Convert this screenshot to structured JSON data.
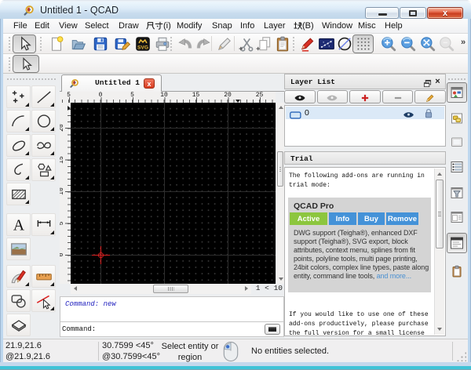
{
  "window": {
    "title": "Untitled 1 - QCAD",
    "controls": [
      {
        "name": "minimize",
        "icon": "minimize-icon"
      },
      {
        "name": "maximize",
        "icon": "maximize-icon"
      },
      {
        "name": "close",
        "icon": "close-icon"
      }
    ]
  },
  "menu_bar": {
    "items": [
      "File",
      "Edit",
      "View",
      "Select",
      "Draw",
      "尺寸(i)",
      "Modify",
      "Snap",
      "Info",
      "Layer",
      "块(B)",
      "Window",
      "Misc",
      "Help"
    ]
  },
  "main_toolbar": {
    "buttons": [
      {
        "name": "selection-pointer",
        "icon": "cursor-arrow",
        "pressed": true
      },
      {
        "name": "new-document",
        "icon": "file-new"
      },
      {
        "name": "open-document",
        "icon": "folder-open"
      },
      {
        "name": "save-document",
        "icon": "floppy-save"
      },
      {
        "name": "save-as",
        "icon": "floppy-edit"
      },
      {
        "name": "svg-export",
        "icon": "svg-export"
      },
      {
        "name": "print",
        "icon": "printer"
      },
      {
        "name": "undo",
        "icon": "arrow-undo"
      },
      {
        "name": "redo",
        "icon": "arrow-redo"
      },
      {
        "name": "draw-white-pencil",
        "icon": "pencil-white"
      },
      {
        "name": "cut",
        "icon": "scissors"
      },
      {
        "name": "copy",
        "icon": "copy-pages"
      },
      {
        "name": "paste",
        "icon": "clipboard-paste"
      },
      {
        "name": "edit-drawing-preferences",
        "icon": "pencil-red"
      },
      {
        "name": "snap-grid-points",
        "icon": "points-panel"
      },
      {
        "name": "restrict-off",
        "icon": "circle-slash"
      },
      {
        "name": "grid-toggle",
        "icon": "grid-dots",
        "pressed": true
      },
      {
        "name": "zoom-in",
        "icon": "magnifier-plus"
      },
      {
        "name": "zoom-out",
        "icon": "magnifier-minus"
      },
      {
        "name": "auto-zoom",
        "icon": "magnifier-fit"
      },
      {
        "name": "previous-view",
        "icon": "magnifier-grey",
        "disabled": true
      }
    ],
    "overflow_label": "»"
  },
  "snap_toolbar": {
    "buttons": [
      {
        "name": "snap-selection-pointer",
        "icon": "cursor-arrow",
        "pressed": true
      }
    ]
  },
  "tool_palette": {
    "tools": [
      {
        "name": "point-tools",
        "icon": "tool-points",
        "flyout": true
      },
      {
        "name": "line-tools",
        "icon": "tool-line",
        "flyout": true
      },
      {
        "name": "arc-tools",
        "icon": "tool-arc",
        "flyout": true
      },
      {
        "name": "circle-tools",
        "icon": "tool-circle",
        "flyout": true
      },
      {
        "name": "ellipse-tools",
        "icon": "tool-ellipse",
        "flyout": true
      },
      {
        "name": "spline-tools",
        "icon": "tool-spline",
        "flyout": true
      },
      {
        "name": "polyline-tools",
        "icon": "tool-polyline",
        "flyout": true
      },
      {
        "name": "shape-tools",
        "icon": "tool-shapes",
        "flyout": true
      },
      {
        "name": "hatch-tool",
        "icon": "tool-hatch",
        "flyout": true
      },
      {
        "name": "text-tool",
        "icon": "tool-text",
        "flyout": false
      },
      {
        "name": "dimension-tools",
        "icon": "tool-dimension",
        "flyout": true
      },
      {
        "name": "image-tool",
        "icon": "tool-image",
        "flyout": false
      },
      {
        "name": "modify-tools",
        "icon": "tool-modify",
        "flyout": true
      },
      {
        "name": "measure-tools",
        "icon": "tool-measure",
        "flyout": true
      },
      {
        "name": "selection-tools",
        "icon": "tool-selection",
        "flyout": false
      },
      {
        "name": "deselect-tools",
        "icon": "tool-deselect",
        "flyout": true
      },
      {
        "name": "projection-tools",
        "icon": "tool-projection",
        "flyout": false
      }
    ]
  },
  "document": {
    "tab": {
      "label": "Untitled 1",
      "icon": "qcad-logo-icon",
      "close_icon": "close-icon"
    },
    "h_ruler_labels": [
      "5",
      "0",
      "5",
      "10",
      "15",
      "20",
      "25"
    ],
    "v_ruler_labels": [
      "20",
      "15",
      "10",
      "5",
      "0",
      "5"
    ],
    "zoom_indicator": "1 < 10"
  },
  "command_widget": {
    "history": "Command: new",
    "prompt_label": "Command:",
    "input_value": ""
  },
  "layer_panel": {
    "title": "Layer List",
    "buttons": [
      {
        "name": "show-all-layers",
        "icon": "eye-dark"
      },
      {
        "name": "hide-all-layers",
        "icon": "eye-grey"
      },
      {
        "name": "add-layer",
        "icon": "plus-red"
      },
      {
        "name": "remove-layer",
        "icon": "minus-grey"
      },
      {
        "name": "edit-layer",
        "icon": "pencil-orange"
      }
    ],
    "layers": [
      {
        "name": "0",
        "selected": true,
        "visible": true,
        "locked": false
      }
    ]
  },
  "trial_panel": {
    "title": "Trial",
    "intro": "The following add-ons are running in trial mode:",
    "card": {
      "title": "QCAD Pro",
      "tabs": [
        {
          "label": "Active",
          "active": true
        },
        {
          "label": "Info",
          "active": false
        },
        {
          "label": "Buy",
          "active": false
        },
        {
          "label": "Remove",
          "active": false
        }
      ],
      "description": "DWG support (Teigha®), enhanced DXF support (Teigha®), SVG export, block attributes, context menu, splines from fit points, polyline tools, multi page printing, 24bit colors, complex line types, paste along entity, command line tools, ",
      "more_link": "and more..."
    },
    "outro": "If you would like to use one of these add-ons productively, please purchase the full version for a small license"
  },
  "dock_toolbar": {
    "buttons": [
      {
        "name": "property-editor",
        "icon": "dock-property-editor",
        "pressed": true
      },
      {
        "name": "block-list",
        "icon": "dock-blocks",
        "pressed": false
      },
      {
        "name": "view-list",
        "icon": "dock-viewport",
        "pressed": false
      },
      {
        "name": "layer-list",
        "icon": "dock-list-rows",
        "pressed": false
      },
      {
        "name": "selection-filter",
        "icon": "dock-funnel",
        "pressed": false
      },
      {
        "name": "command-line-toggle",
        "icon": "dock-page-lines",
        "pressed": false
      },
      {
        "name": "library-browser",
        "icon": "dock-window-panel",
        "pressed": true
      },
      {
        "name": "clipboard-panel",
        "icon": "dock-clipboard",
        "pressed": false
      }
    ]
  },
  "status_bar": {
    "absolute_coordinates": "21.9,21.6",
    "relative_coordinates": "@21.9,21.6",
    "absolute_polar": "30.7599 <45°",
    "relative_polar": "@30.7599<45°",
    "left_button_hint": "Select entity or region",
    "mouse_icon": "mouse-icon",
    "selection_status": "No entities selected."
  },
  "colors": {
    "titlebar_blue": "#bcd4ea",
    "close_button_red": "#c6381d",
    "canvas_black": "#000000",
    "crosshair_red": "#dd2222",
    "selection_row_blue": "#dbe9f7",
    "tab_active_green": "#8cc63e",
    "tab_blue": "#4492d8",
    "link_blue": "#4a90d2",
    "border_teal": "#3fc3d7"
  }
}
